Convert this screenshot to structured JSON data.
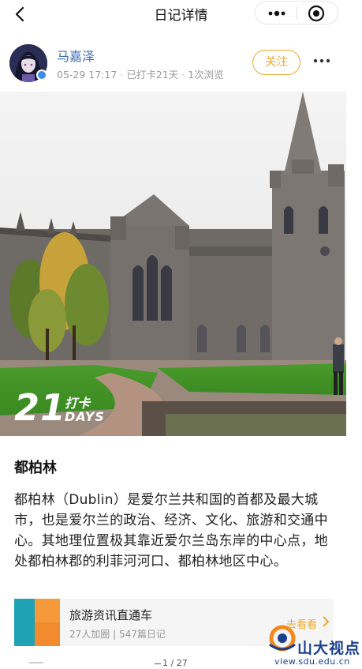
{
  "nav": {
    "title": "日记详情"
  },
  "author": {
    "name": "马嘉泽",
    "date": "05-29 17:17",
    "checkin": "已打卡21天",
    "views": "1次浏览",
    "follow_label": "关注"
  },
  "hero": {
    "streak_number": "21",
    "streak_cn": "打卡",
    "streak_en": "DAYS"
  },
  "post": {
    "title": "都柏林",
    "body": "都柏林（Dublin）是爱尔兰共和国的首都及最大城市，也是爱尔兰的政治、经济、文化、旅游和交通中心。其地理位置极其靠近爱尔兰岛东岸的中心点，地处都柏林郡的利菲河河口、都柏林地区中心。"
  },
  "group_card": {
    "title": "旅游资讯直通车",
    "members": "27人加圈",
    "diaries": "547篇日记",
    "link": "去看看"
  },
  "pager": {
    "current": "1",
    "total": "27"
  },
  "watermark": {
    "name": "山大视点",
    "url": "view.sdu.edu.cn"
  },
  "colors": {
    "accent": "#f0a82a",
    "author_name": "#3b69b3",
    "meta": "#999999"
  }
}
